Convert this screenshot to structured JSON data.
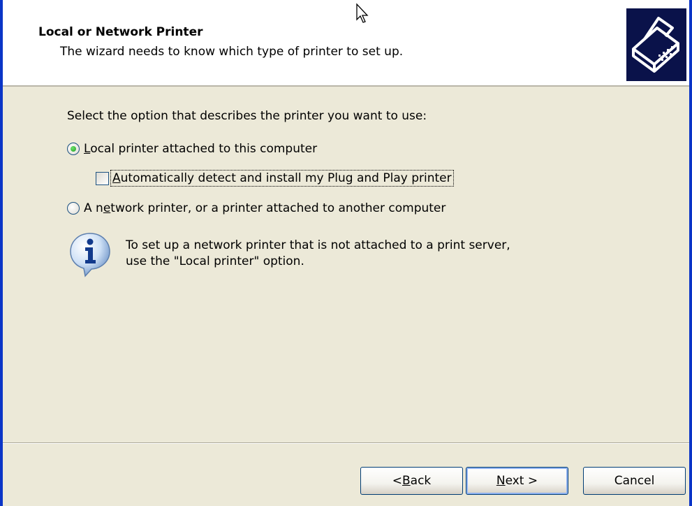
{
  "header": {
    "title": "Local or Network Printer",
    "subtitle": "The wizard needs to know which type of printer to set up."
  },
  "body": {
    "prompt": "Select the option that describes the printer you want to use:",
    "options": [
      {
        "pre": "",
        "mnemonic": "L",
        "post": "ocal printer attached to this computer",
        "checked": true
      },
      {
        "pre": "A n",
        "mnemonic": "e",
        "post": "twork printer, or a printer attached to another computer",
        "checked": false
      }
    ],
    "auto_detect": {
      "pre": "",
      "mnemonic": "A",
      "post": "utomatically detect and install my Plug and Play printer",
      "checked": false
    },
    "info": {
      "line1": "To set up a network printer that is not attached to a print server,",
      "line2": "use the \"Local printer\" option."
    }
  },
  "footer": {
    "back": {
      "pre": "< ",
      "mnemonic": "B",
      "post": "ack"
    },
    "next": {
      "pre": "",
      "mnemonic": "N",
      "post": "ext >"
    },
    "cancel": "Cancel"
  },
  "icons": {
    "header": "printer-icon",
    "info": "info-icon",
    "cursor": "mouse-cursor-icon"
  },
  "colors": {
    "window_border": "#0b35c7",
    "dialog_background": "#ece9d8",
    "header_background": "#ffffff",
    "icon_background": "#0a124a",
    "radio_check": "#21a121"
  }
}
